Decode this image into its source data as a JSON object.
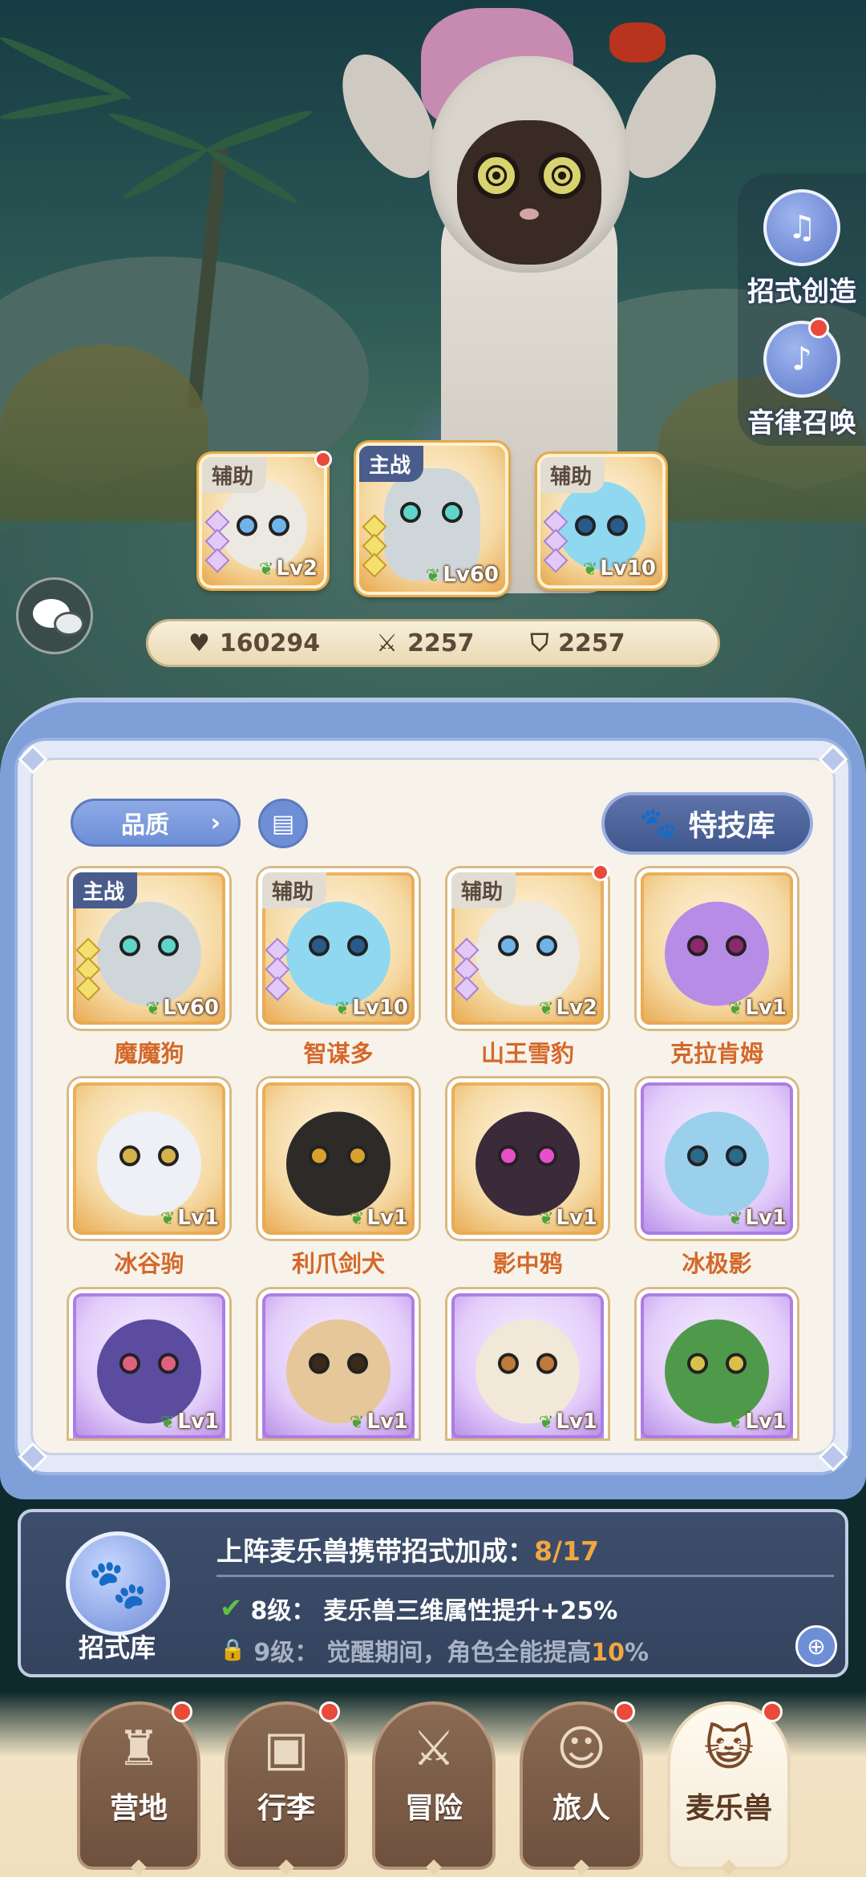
{
  "side_menu": {
    "move_create": "招式创造",
    "melody_summon": "音律召唤"
  },
  "team": [
    {
      "tag": "辅助",
      "level": "Lv2",
      "stars": 3,
      "star_color": "purple",
      "has_dot": true
    },
    {
      "tag": "主战",
      "level": "Lv60",
      "stars": 3,
      "star_color": "gold",
      "has_dot": false
    },
    {
      "tag": "辅助",
      "level": "Lv10",
      "stars": 3,
      "star_color": "purple",
      "has_dot": false
    }
  ],
  "stats": {
    "hp": "160294",
    "attack": "2257",
    "defense": "2257"
  },
  "toolbar": {
    "quality": "品质",
    "skills_library": "特技库"
  },
  "pets": [
    {
      "name": "魔魔狗",
      "tag": "主战",
      "level": "Lv60",
      "rarity": "gold"
    },
    {
      "name": "智谋多",
      "tag": "辅助",
      "level": "Lv10",
      "rarity": "gold"
    },
    {
      "name": "山王雪豹",
      "tag": "辅助",
      "level": "Lv2",
      "rarity": "gold"
    },
    {
      "name": "克拉肯姆",
      "tag": "",
      "level": "Lv1",
      "rarity": "gold"
    },
    {
      "name": "冰谷驹",
      "tag": "",
      "level": "Lv1",
      "rarity": "gold"
    },
    {
      "name": "利爪剑犬",
      "tag": "",
      "level": "Lv1",
      "rarity": "gold"
    },
    {
      "name": "影中鸦",
      "tag": "",
      "level": "Lv1",
      "rarity": "gold"
    },
    {
      "name": "冰极影",
      "tag": "",
      "level": "Lv1",
      "rarity": "purple"
    },
    {
      "name": "",
      "tag": "",
      "level": "Lv1",
      "rarity": "purple"
    },
    {
      "name": "",
      "tag": "",
      "level": "Lv1",
      "rarity": "purple"
    },
    {
      "name": "",
      "tag": "",
      "level": "Lv1",
      "rarity": "purple"
    },
    {
      "name": "",
      "tag": "",
      "level": "Lv1",
      "rarity": "purple"
    }
  ],
  "bonus": {
    "library_label": "招式库",
    "title": "上阵麦乐兽携带招式加成：",
    "progress": "8/17",
    "row1_level": "8级：",
    "row1_text": "麦乐兽三维属性提升+25%",
    "row2_level": "9级：",
    "row2_text_a": "觉醒期间，角色全能提高",
    "row2_highlight": "10",
    "row2_text_b": "%"
  },
  "nav": [
    {
      "label": "营地",
      "icon": "castle-icon",
      "dot": true,
      "active": false
    },
    {
      "label": "行李",
      "icon": "backpack-icon",
      "dot": true,
      "active": false
    },
    {
      "label": "冒险",
      "icon": "crossed-swords-icon",
      "dot": false,
      "active": false
    },
    {
      "label": "旅人",
      "icon": "traveler-icon",
      "dot": true,
      "active": false
    },
    {
      "label": "麦乐兽",
      "icon": "pet-icon",
      "dot": true,
      "active": true
    }
  ],
  "colors": {
    "accent_orange": "#f1a741",
    "pet_name": "#d4682a",
    "panel_blue": "#7f9fd9",
    "notification_red": "#e94a3a"
  }
}
